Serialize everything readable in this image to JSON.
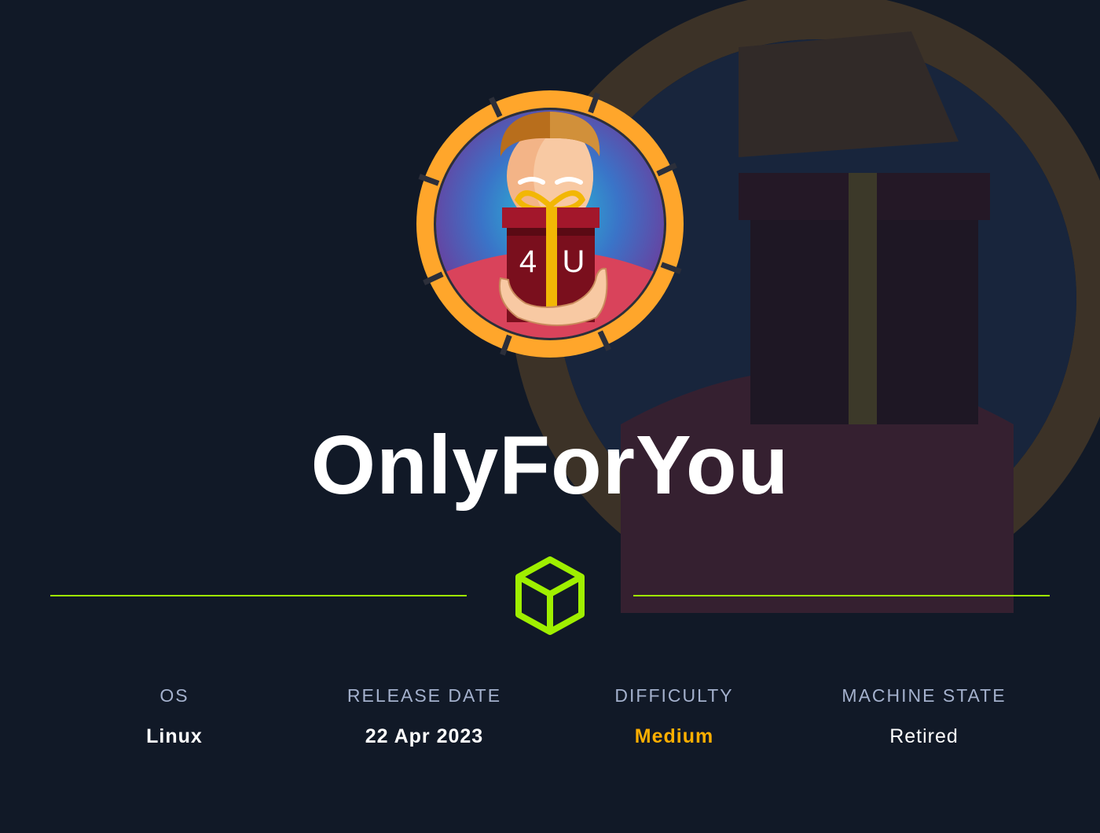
{
  "machine": {
    "name": "OnlyForYou",
    "logo_icon": "gift-box-avatar",
    "badge_text": "4U"
  },
  "divider": {
    "icon": "hackthebox-cube-icon",
    "color": "#9fef00"
  },
  "stats": {
    "os": {
      "label": "OS",
      "value": "Linux"
    },
    "release_date": {
      "label": "RELEASE DATE",
      "value": "22 Apr 2023"
    },
    "difficulty": {
      "label": "DIFFICULTY",
      "value": "Medium",
      "color": "#ffaf00"
    },
    "machine_state": {
      "label": "MACHINE STATE",
      "value": "Retired"
    }
  },
  "colors": {
    "background": "#111927",
    "ring": "#ffa62b",
    "accent": "#9fef00"
  }
}
